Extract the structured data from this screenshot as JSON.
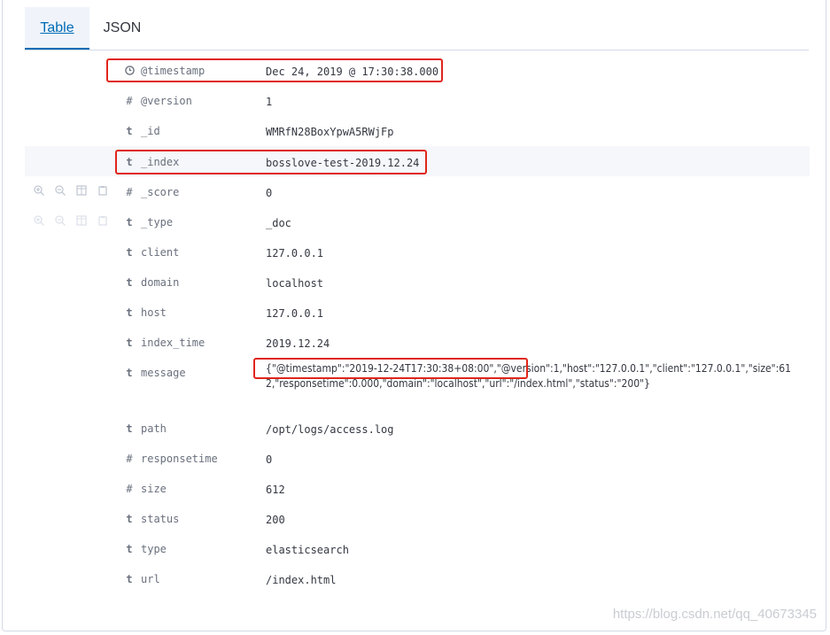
{
  "tabs": [
    {
      "label": "Table",
      "selected": true
    },
    {
      "label": "JSON",
      "selected": false
    }
  ],
  "rows": [
    {
      "type_icon": "clock-icon",
      "field": "@timestamp",
      "value": "Dec 24, 2019 @ 17:30:38.000"
    },
    {
      "type": "#",
      "field": "@version",
      "value": "1"
    },
    {
      "type": "t",
      "field": "_id",
      "value": "WMRfN28BoxYpwA5RWjFp"
    },
    {
      "type": "t",
      "field": "_index",
      "value": "bosslove-test-2019.12.24"
    },
    {
      "type": "#",
      "field": "_score",
      "value": "0"
    },
    {
      "type": "t",
      "field": "_type",
      "value": "_doc"
    },
    {
      "type": "t",
      "field": "client",
      "value": "127.0.0.1"
    },
    {
      "type": "t",
      "field": "domain",
      "value": "localhost"
    },
    {
      "type": "t",
      "field": "host",
      "value": "127.0.0.1"
    },
    {
      "type": "t",
      "field": "index_time",
      "value": "2019.12.24"
    },
    {
      "type": "t",
      "field": "message",
      "value": "{\"@timestamp\":\"2019-12-24T17:30:38+08:00\",\"@version\":1,\"host\":\"127.0.0.1\",\"client\":\"127.0.0.1\",\"size\":612,\"responsetime\":0.000,\"domain\":\"localhost\",\"url\":\"/index.html\",\"status\":\"200\"}"
    },
    {
      "type": "t",
      "field": "path",
      "value": "/opt/logs/access.log"
    },
    {
      "type": "#",
      "field": "responsetime",
      "value": "0"
    },
    {
      "type": "#",
      "field": "size",
      "value": "612"
    },
    {
      "type": "t",
      "field": "status",
      "value": "200"
    },
    {
      "type": "t",
      "field": "type",
      "value": "elasticsearch"
    },
    {
      "type": "t",
      "field": "url",
      "value": "/index.html"
    }
  ],
  "row_actions": [
    "zoom-in-icon",
    "zoom-out-icon",
    "toggle-column-icon",
    "filter-exists-icon"
  ],
  "annotation_color": "#e0251b",
  "watermark": "https://blog.csdn.net/qq_40673345"
}
